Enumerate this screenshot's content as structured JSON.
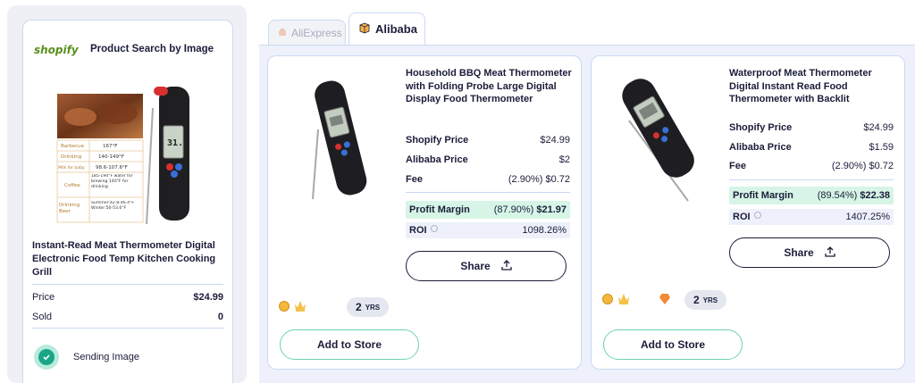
{
  "left": {
    "logo_text": "shopify",
    "title": "Product Search by Image",
    "product_title": "Instant-Read Meat Thermometer Digital Electronic Food Temp Kitchen Cooking Grill",
    "price_label": "Price",
    "price_value": "$24.99",
    "sold_label": "Sold",
    "sold_value": "0",
    "status_text": "Sending Image",
    "image_table": [
      {
        "label": "Barbecue",
        "value": "167°F"
      },
      {
        "label": "Drinking",
        "value": "140-149°F"
      },
      {
        "label": "Milk for baby",
        "value": "98.6-107.6°F"
      },
      {
        "label": "Coffee",
        "value": "185-194°F water for brewing 140°F for drinking"
      },
      {
        "label": "Drinking Beer",
        "value": "Summer:42.8-46.4°F Winter:50-53.6°F"
      }
    ],
    "image_readout": "31.5"
  },
  "tabs": [
    {
      "label": "AliExpress",
      "active": false
    },
    {
      "label": "Alibaba",
      "active": true
    }
  ],
  "products": [
    {
      "title": "Household BBQ Meat Thermometer with Folding Probe Large Digital Display Food Thermometer",
      "shopify_price_label": "Shopify Price",
      "shopify_price": "$24.99",
      "alibaba_price_label": "Alibaba Price",
      "alibaba_price": "$2",
      "fee_label": "Fee",
      "fee": "(2.90%) $0.72",
      "margin_label": "Profit Margin",
      "margin_pct": "(87.90%)",
      "margin_value": "$21.97",
      "roi_label": "ROI",
      "roi_value": "1098.26%",
      "share_label": "Share",
      "years": "2",
      "years_unit": "YRS",
      "add_label": "Add to Store"
    },
    {
      "title": "Waterproof Meat Thermometer Digital Instant Read Food Thermometer with Backlit",
      "shopify_price_label": "Shopify Price",
      "shopify_price": "$24.99",
      "alibaba_price_label": "Alibaba Price",
      "alibaba_price": "$1.59",
      "fee_label": "Fee",
      "fee": "(2.90%) $0.72",
      "margin_label": "Profit Margin",
      "margin_pct": "(89.54%)",
      "margin_value": "$22.38",
      "roi_label": "ROI",
      "roi_value": "1407.25%",
      "share_label": "Share",
      "years": "2",
      "years_unit": "YRS",
      "add_label": "Add to Store"
    }
  ],
  "colors": {
    "accent_green": "#1aa586",
    "margin_bg": "#d6f5e6",
    "border": "#c9d9f3",
    "text": "#1b1d3a"
  }
}
